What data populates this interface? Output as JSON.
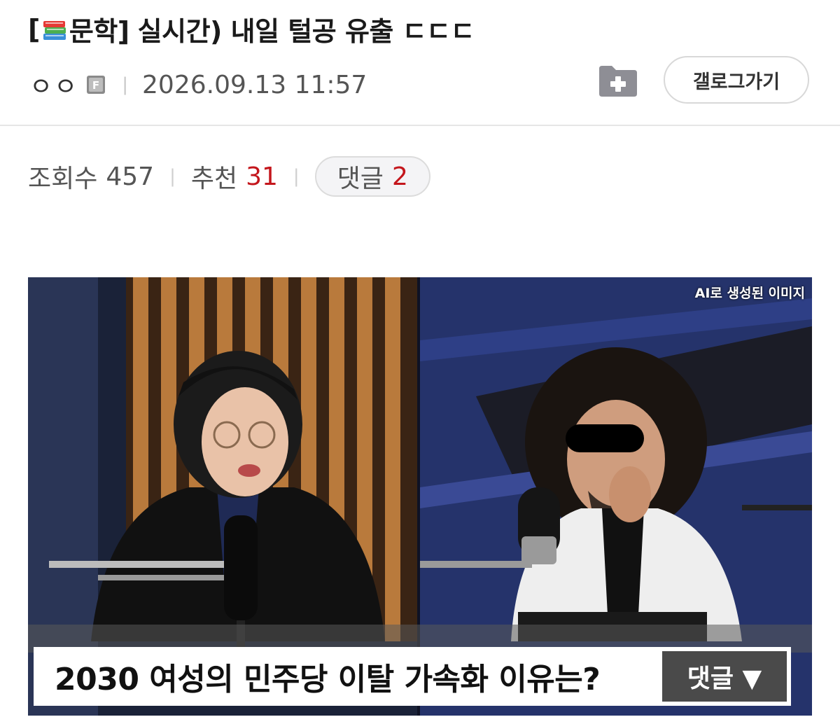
{
  "post": {
    "category_open": "[",
    "category_icon": "books-icon",
    "category": "문학]",
    "title": "실시간) 내일 털공 유출 ㄷㄷㄷ",
    "author": "ㅇㅇ",
    "author_level_icon": "fixed-nick-icon",
    "date": "2026.09.13 11:57"
  },
  "actions": {
    "folder_icon": "folder-add-icon",
    "gallery_label": "갤로그가기"
  },
  "stats": {
    "views_label": "조회수",
    "views": "457",
    "recommend_label": "추천",
    "recommend": "31",
    "comments_label": "댓글",
    "comments": "2"
  },
  "image": {
    "ai_label": "AI로 생성된 이미지",
    "caption": "2030 여성의 민주당 이탈 가속화 이유는?",
    "caption_button": "댓글 ▼"
  },
  "colors": {
    "accent_red": "#c4161c",
    "pill_bg": "#f4f4f6"
  }
}
